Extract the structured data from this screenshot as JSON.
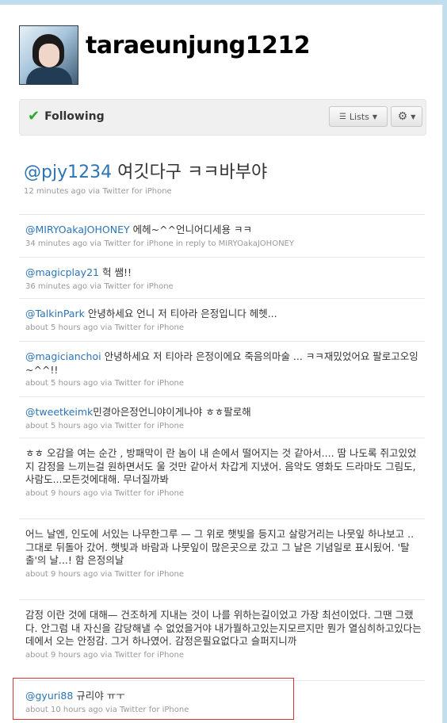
{
  "profile": {
    "username": "taraeunjung1212"
  },
  "follow_bar": {
    "status": "Following",
    "lists_label": "Lists",
    "gear_icon": "gear-icon"
  },
  "main_tweet": {
    "mention": "@pjy1234",
    "text": " 여깃다구 ㅋㅋ바부야",
    "meta": "12 minutes ago via Twitter for iPhone"
  },
  "tweets": [
    {
      "mention": "@MIRYOakaJOHONEY",
      "text": " 에헤~^^언니어디세용 ㅋㅋ",
      "meta": "34 minutes ago via Twitter for iPhone in reply to MIRYOakaJOHONEY"
    },
    {
      "mention": "@magicplay21",
      "text": " 헉 쌤!!",
      "meta": "36 minutes ago via Twitter for iPhone"
    },
    {
      "mention": "@TalkinPark",
      "text": " 안녕하세요 언니 저 티아라 은정입니다 헤헷...",
      "meta": "about 5 hours ago via Twitter for iPhone"
    },
    {
      "mention": "@magicianchoi",
      "text": " 안녕하세요 저 티아라 은정이에요 죽음의마술 ... ㅋㅋ재밌었어요 팔로고오잉~^^!!",
      "meta": "about 5 hours ago via Twitter for iPhone"
    },
    {
      "mention": "@tweetkeimk",
      "text": "민경아은정언니야이게나야 ㅎㅎ팔로해",
      "meta": "about 5 hours ago via Twitter for iPhone"
    },
    {
      "mention": "",
      "text": "ㅎㅎ 오감을 여는 순간 , 방패막이 란 놈이 내 손에서 떨어지는 것 같아서.... 땀 나도록 쥐고있었지 감정을 느끼는걸 원하면서도 울 것만 같아서 차갑게 지냈어. 음악도 영화도 드라마도 그림도,사람도...모든것에대해. 무너질까봐",
      "meta": "about 9 hours ago via Twitter for iPhone"
    },
    {
      "mention": "",
      "text": "어느 날엔, 인도에 서있는 나무한그루 — 그 위로 햇빛을 등지고 살랑거리는 나뭇잎 하나보고 .. 그대로 뒤돌아 갔어. 햇빛과 바람과 나뭇잎이 많은곳으로 갔고 그 날은 기념일로 표시됬어. '탈출'의 날...! 함 은정의날",
      "meta": "about 9 hours ago via Twitter for iPhone"
    },
    {
      "mention": "",
      "text": "감정 이란 것에 대해— 건조하게 지내는 것이 나를 위하는길이었고 가장 최선이었다. 그땐 그랬다. 안그럼 내 자신을 감당해낼 수 없었을거야 내가뭘하고있는지모르지만 뭔가 열심히하고있다는 데에서 오는 안정감. 그거 하나였어. 감정은필요없다고 슬퍼지니까",
      "meta": "about 9 hours ago via Twitter for iPhone"
    },
    {
      "mention": "@gyuri88",
      "text": " 규리야 ㅠㅜ",
      "meta": "about 10 hours ago via Twitter for iPhone"
    }
  ]
}
